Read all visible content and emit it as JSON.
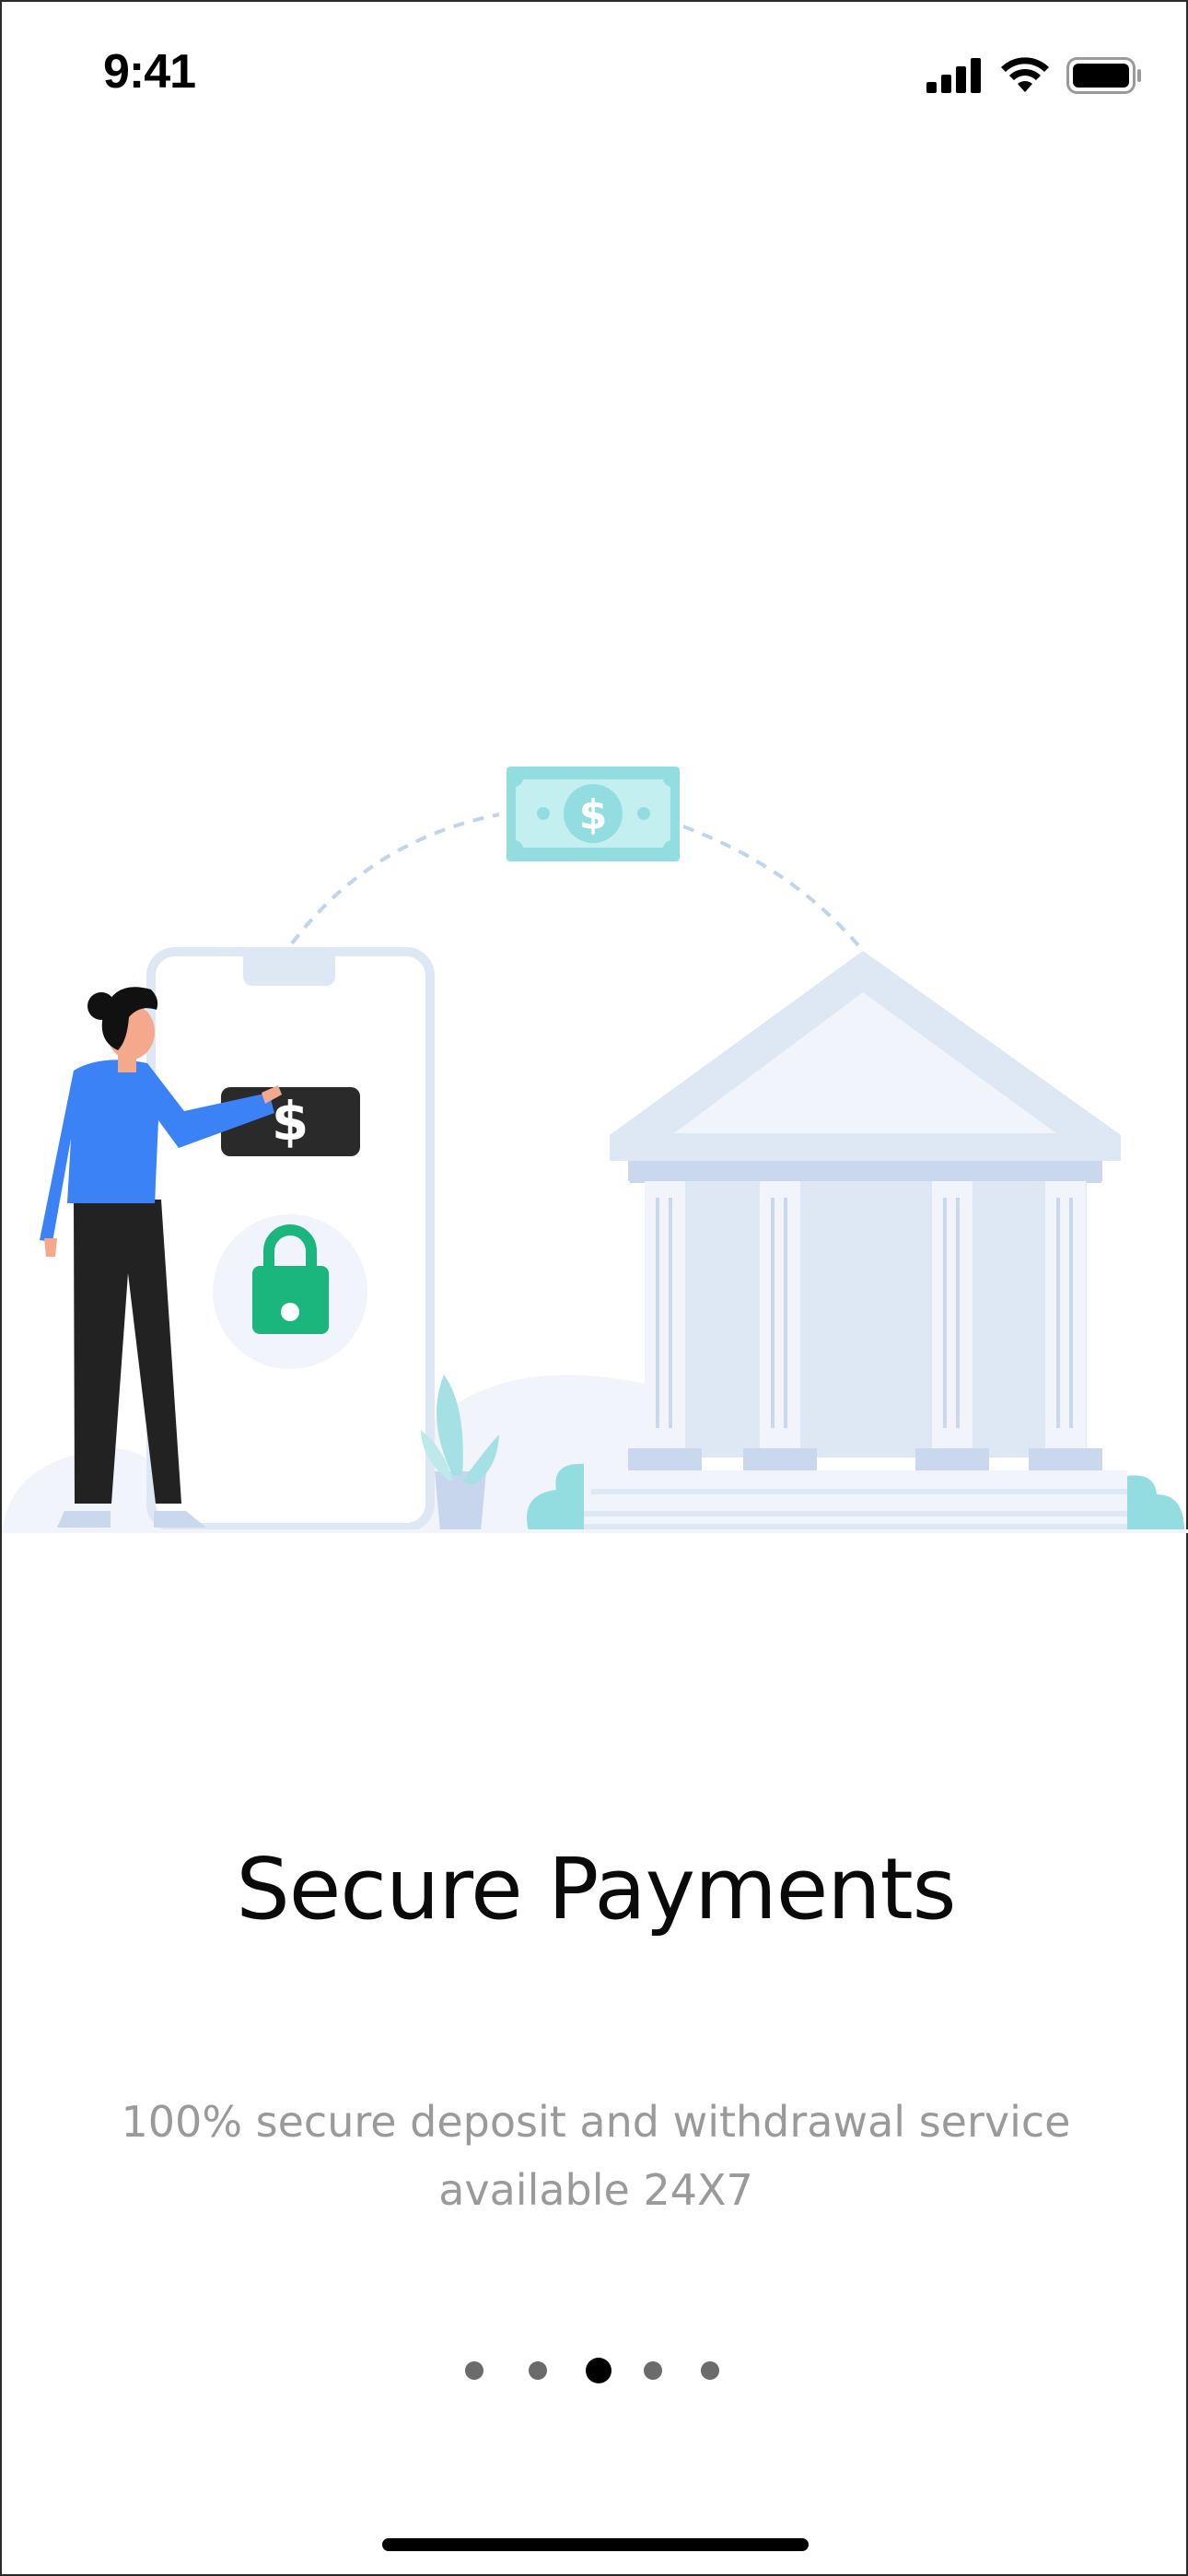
{
  "status_bar": {
    "time": "9:41",
    "icons": [
      "cellular-signal-icon",
      "wifi-icon",
      "battery-icon"
    ]
  },
  "illustration": {
    "subject": "secure-payment-illustration",
    "banknote_symbol": "$",
    "payment_tag_symbol": "$",
    "icons": [
      "banknote-icon",
      "smartphone-icon",
      "padlock-icon",
      "bank-building-icon",
      "person-figure",
      "plant-icon"
    ]
  },
  "onboarding": {
    "title": "Secure Payments",
    "description": "100% secure deposit and withdrawal service available 24X7"
  },
  "pager": {
    "total": 5,
    "active_index": 2
  },
  "colors": {
    "accent_green": "#1BB67E",
    "person_shirt": "#3B82F6",
    "light_blue": "#DEE7F4",
    "teal": "#8FDDE0"
  }
}
